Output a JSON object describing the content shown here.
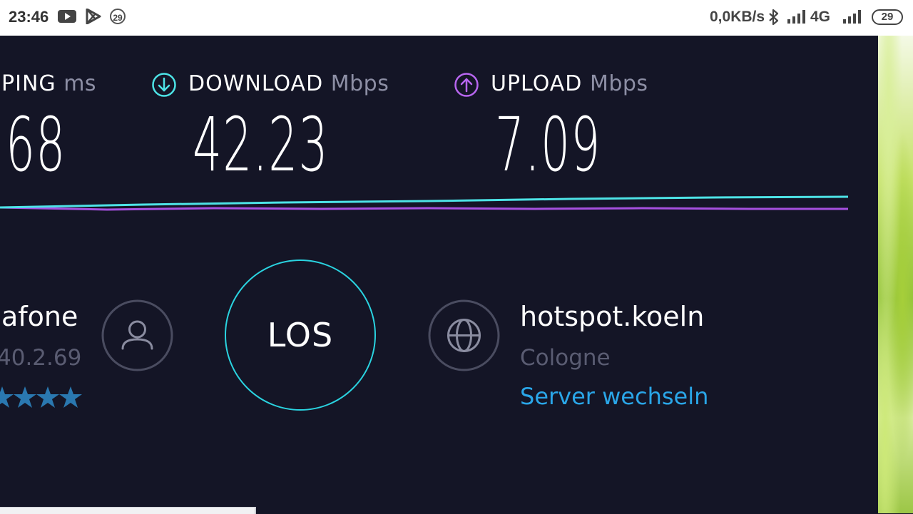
{
  "status_bar": {
    "time": "23:46",
    "notification_badge": "29",
    "net_speed": "0,0KB/s",
    "network_type": "4G",
    "battery": "29",
    "icons": [
      "youtube-icon",
      "play-store-icon",
      "bluetooth-icon",
      "signal-icon"
    ]
  },
  "metrics": {
    "ping": {
      "label": "PING",
      "unit": "ms",
      "value": "68"
    },
    "download": {
      "label": "DOWNLOAD",
      "unit": "Mbps",
      "value": "42.23",
      "color": "#4de3e6"
    },
    "upload": {
      "label": "UPLOAD",
      "unit": "Mbps",
      "value": "7.09",
      "color": "#b866f0"
    }
  },
  "provider": {
    "name": "afone",
    "ip": "40.2.69",
    "rating_stars": 4
  },
  "go_button": {
    "label": "LOS"
  },
  "server": {
    "host": "hotspot.koeln",
    "city": "Cologne",
    "change_label": "Server wechseln"
  },
  "colors": {
    "background": "#141526",
    "accent_cyan": "#2ad3e0",
    "accent_purple": "#a650e0",
    "link_blue": "#2aa6e8",
    "muted_text": "#5a5c72"
  }
}
